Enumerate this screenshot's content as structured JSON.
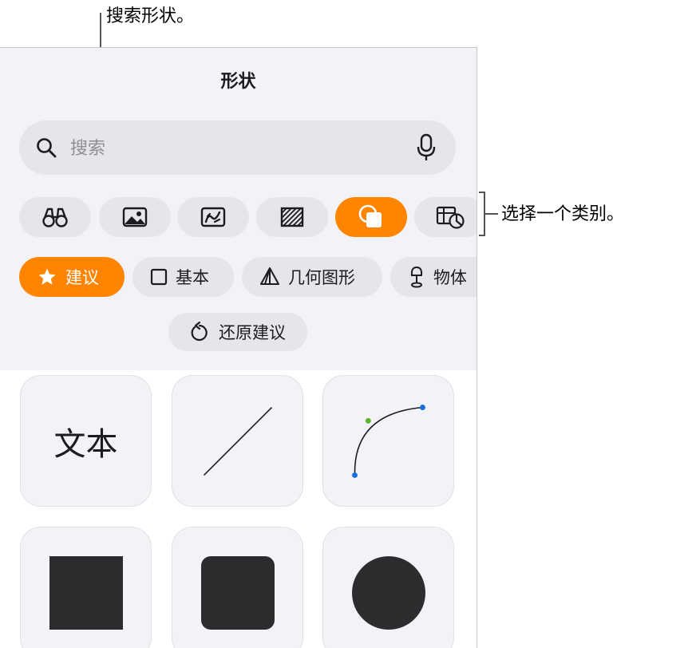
{
  "callouts": {
    "search": "搜索形状。",
    "category": "选择一个类别。"
  },
  "panel": {
    "title": "形状",
    "search": {
      "placeholder": "搜索",
      "left_icon": "search-icon",
      "right_icon": "microphone-icon"
    },
    "categories": [
      {
        "icon": "binoculars-icon",
        "selected": false
      },
      {
        "icon": "photo-icon",
        "selected": false
      },
      {
        "icon": "drawing-icon",
        "selected": false
      },
      {
        "icon": "texture-icon",
        "selected": false
      },
      {
        "icon": "shapes-icon",
        "selected": true
      },
      {
        "icon": "chart-table-icon",
        "selected": false
      }
    ],
    "chips": [
      {
        "label": "建议",
        "icon": "star-icon",
        "selected": true
      },
      {
        "label": "基本",
        "icon": "square-outline-icon",
        "selected": false
      },
      {
        "label": "几何图形",
        "icon": "pyramid-icon",
        "selected": false
      },
      {
        "label": "物体",
        "icon": "lamp-icon",
        "selected": false
      }
    ],
    "restore_label": "还原建议",
    "tiles": [
      {
        "kind": "text",
        "label": "文本"
      },
      {
        "kind": "line"
      },
      {
        "kind": "curve"
      },
      {
        "kind": "square"
      },
      {
        "kind": "rounded-square"
      },
      {
        "kind": "circle"
      }
    ]
  },
  "colors": {
    "accent": "#ff8400",
    "panel_bg": "#f2f2f7",
    "control_bg": "#e5e5ea",
    "shape_fill": "#2c2c2e",
    "curve_endpoint": "#1a6fe0",
    "curve_control": "#5bb52a"
  }
}
